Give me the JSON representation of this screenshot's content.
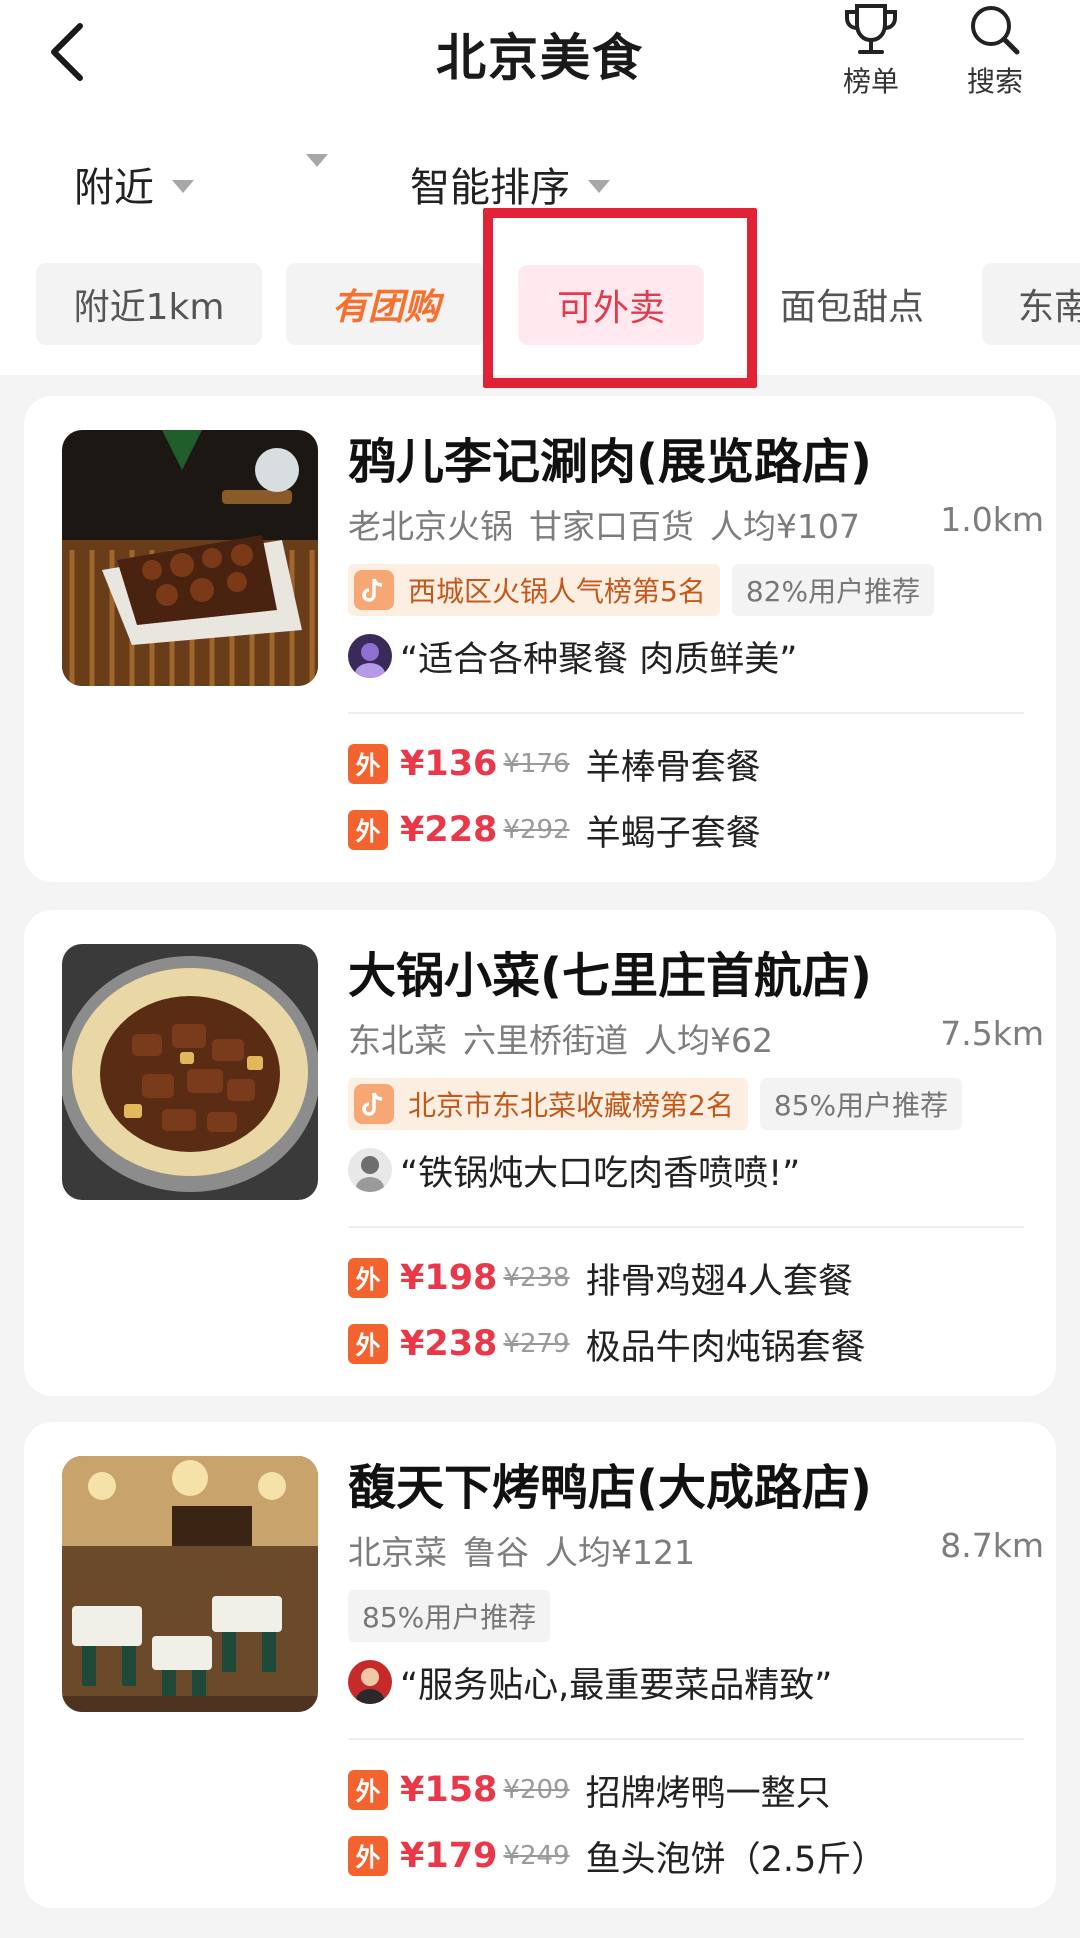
{
  "header": {
    "title": "北京美食",
    "rank_label": "榜单",
    "search_label": "搜索"
  },
  "filters": {
    "nearby": "附近",
    "sort": "智能排序"
  },
  "tags": [
    "附近1km",
    "有团购",
    "可外卖",
    "面包甜点",
    "东南"
  ],
  "shops": [
    {
      "name": "鸦儿李记涮肉(展览路店)",
      "category": "老北京火锅",
      "area": "甘家口百货",
      "avg_price": "人均¥107",
      "distance": "1.0km",
      "rank_badge": "西城区火锅人气榜第5名",
      "recommend": "82%用户推荐",
      "review": "“适合各种聚餐 肉质鲜美”",
      "deals": [
        {
          "tag": "外",
          "price": "¥136",
          "original": "¥176",
          "name": "羊棒骨套餐"
        },
        {
          "tag": "外",
          "price": "¥228",
          "original": "¥292",
          "name": "羊蝎子套餐"
        }
      ]
    },
    {
      "name": "大锅小菜(七里庄首航店)",
      "category": "东北菜",
      "area": "六里桥街道",
      "avg_price": "人均¥62",
      "distance": "7.5km",
      "rank_badge": "北京市东北菜收藏榜第2名",
      "recommend": "85%用户推荐",
      "review": "“铁锅炖大口吃肉香喷喷!”",
      "deals": [
        {
          "tag": "外",
          "price": "¥198",
          "original": "¥238",
          "name": "排骨鸡翅4人套餐"
        },
        {
          "tag": "外",
          "price": "¥238",
          "original": "¥279",
          "name": "极品牛肉炖锅套餐"
        }
      ]
    },
    {
      "name": "馥天下烤鸭店(大成路店)",
      "category": "北京菜",
      "area": "鲁谷",
      "avg_price": "人均¥121",
      "distance": "8.7km",
      "recommend": "85%用户推荐",
      "review": "“服务贴心,最重要菜品精致”",
      "deals": [
        {
          "tag": "外",
          "price": "¥158",
          "original": "¥209",
          "name": "招牌烤鸭一整只"
        },
        {
          "tag": "外",
          "price": "¥179",
          "original": "¥249",
          "name": "鱼头泡饼（2.5斤）"
        }
      ]
    }
  ],
  "colors": {
    "accent_red": "#e8384a",
    "highlight_box": "#e02336",
    "group_orange": "#fb6f2e",
    "badge_orange": "#c4581b"
  }
}
